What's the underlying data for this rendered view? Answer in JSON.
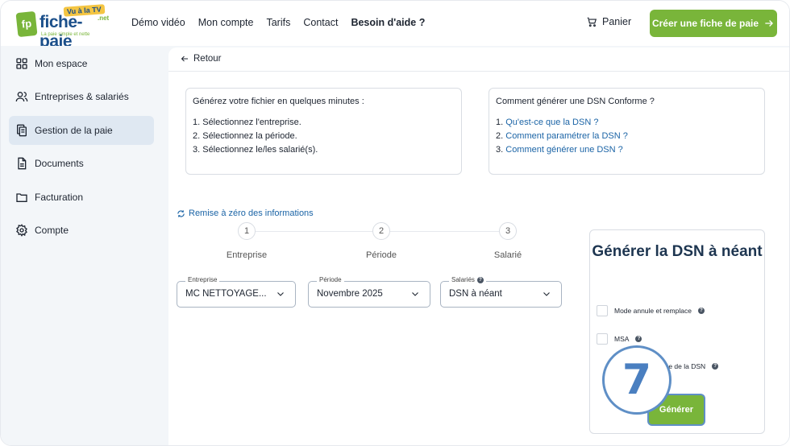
{
  "header": {
    "logo": {
      "badge": "fp",
      "name": "fiche-paie",
      "tv_badge": "Vu à la TV",
      "net": ".net",
      "tagline": "La paie simple et nette"
    },
    "nav": [
      "Démo vidéo",
      "Mon compte",
      "Tarifs",
      "Contact"
    ],
    "help": "Besoin d'aide ?",
    "cart": "Panier",
    "cta": "Créer une fiche de paie"
  },
  "sidebar": {
    "items": [
      {
        "label": "Mon espace",
        "icon": "grid-icon"
      },
      {
        "label": "Entreprises & salariés",
        "icon": "users-icon"
      },
      {
        "label": "Gestion de la paie",
        "icon": "payslip-icon",
        "active": true
      },
      {
        "label": "Documents",
        "icon": "document-icon"
      },
      {
        "label": "Facturation",
        "icon": "folder-icon"
      },
      {
        "label": "Compte",
        "icon": "gear-icon"
      }
    ]
  },
  "main": {
    "back": "Retour",
    "info_left": {
      "title": "Générez votre fichier en quelques minutes :",
      "lines": [
        "1. Sélectionnez l'entreprise.",
        "2. Sélectionnez la période.",
        "3. Sélectionnez le/les salarié(s)."
      ]
    },
    "info_right": {
      "title": "Comment générer une DSN Conforme ?",
      "links": [
        {
          "num": "1.",
          "text": "Qu'est-ce que la DSN ?"
        },
        {
          "num": "2.",
          "text": "Comment paramétrer la DSN ?"
        },
        {
          "num": "3.",
          "text": "Comment générer une DSN ?"
        }
      ]
    },
    "reset": "Remise à zéro des informations",
    "steps": [
      {
        "num": "1",
        "label": "Entreprise"
      },
      {
        "num": "2",
        "label": "Période"
      },
      {
        "num": "3",
        "label": "Salarié"
      }
    ],
    "selects": [
      {
        "label": "Entreprise",
        "value": "MC NETTOYAGE..."
      },
      {
        "label": "Période",
        "value": "Novembre 2025"
      },
      {
        "label": "Salariés",
        "value": "DSN à néant"
      }
    ],
    "card": {
      "title": "Générer la DSN à néant",
      "options": [
        "Mode annule et remplace",
        "MSA",
        "ique de la DSN"
      ],
      "button": "Générer"
    },
    "step_indicator": "7"
  },
  "colors": {
    "accent_green": "#79b53a",
    "link_blue": "#1b64a6",
    "brand_blue": "#1b4f8a",
    "sidebar_bg": "#f3f6f9"
  }
}
